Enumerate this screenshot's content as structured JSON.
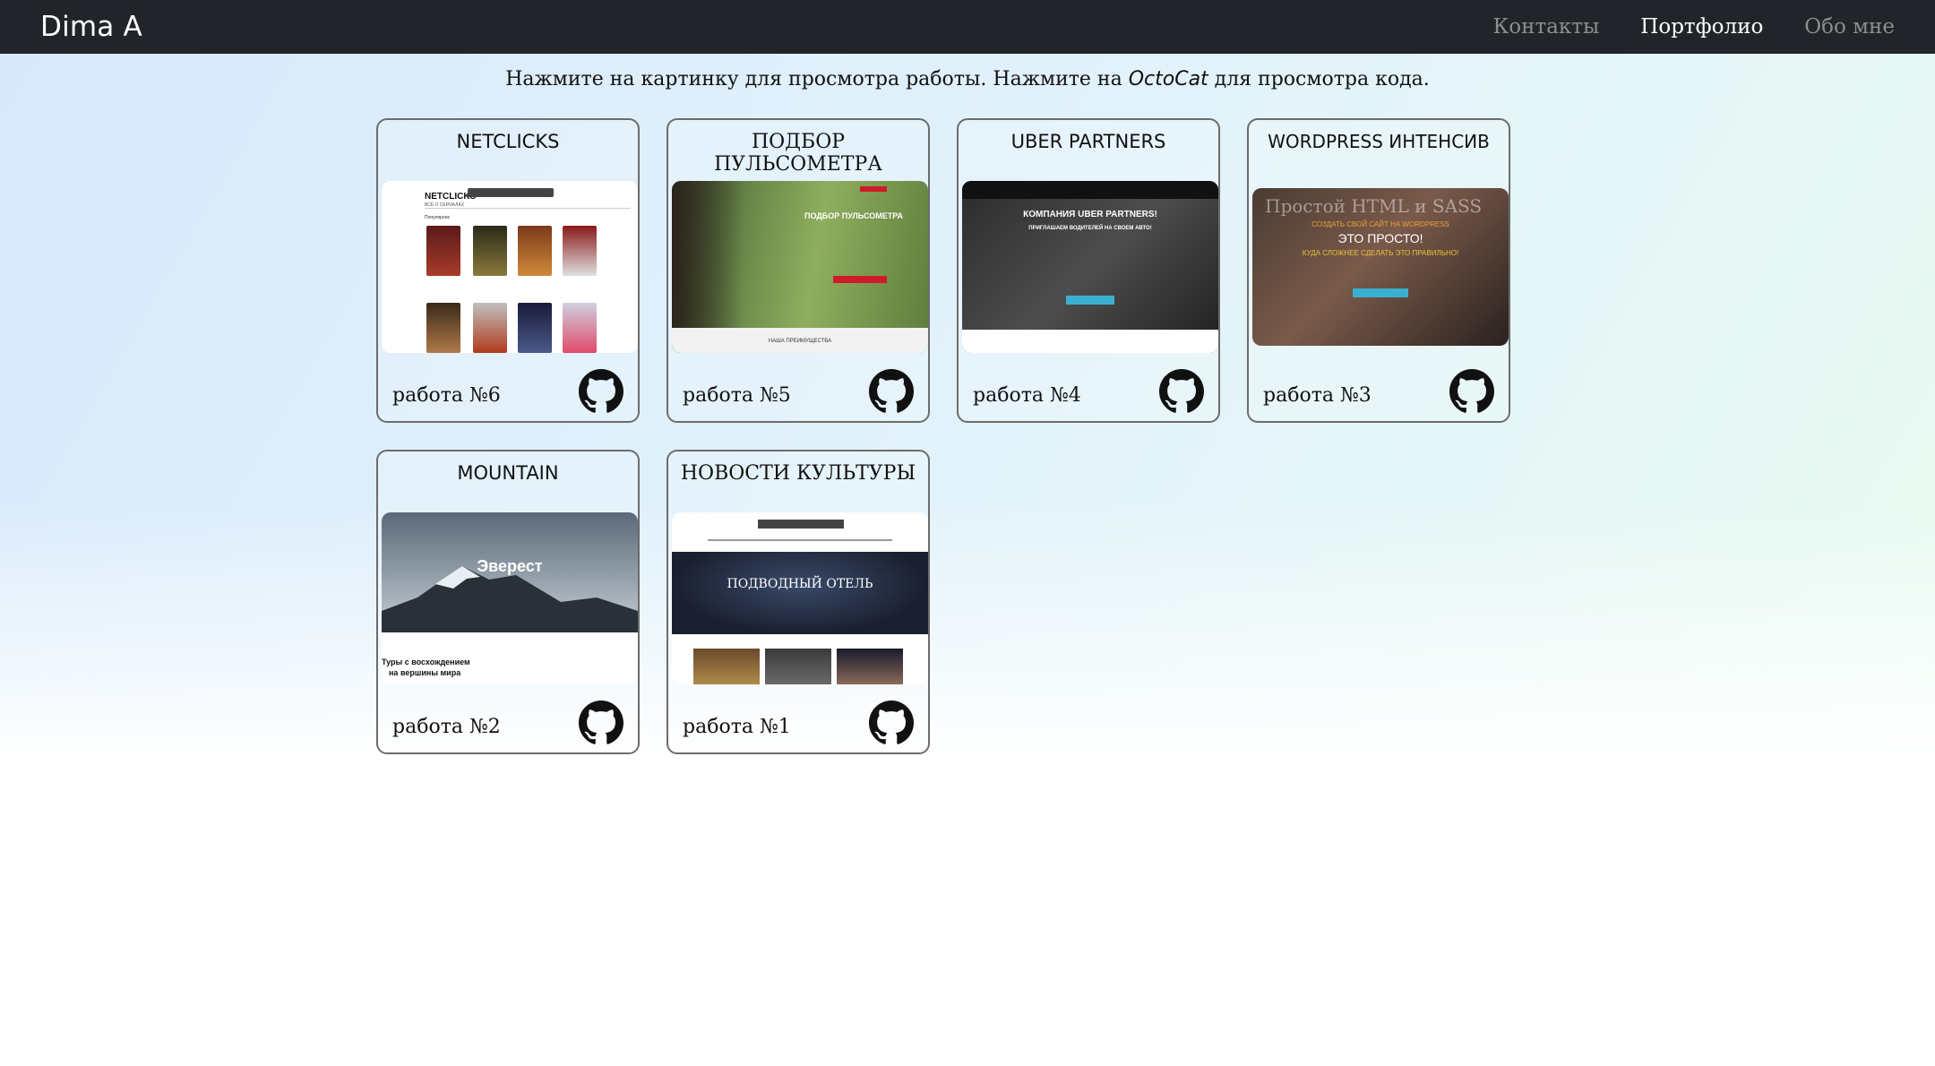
{
  "navbar": {
    "brand": "Dima A",
    "links": [
      {
        "label": "Контакты",
        "active": false
      },
      {
        "label": "Портфолио",
        "active": true
      },
      {
        "label": "Обо мне",
        "active": false
      }
    ]
  },
  "hint": {
    "before": "Нажмите на картинку для просмотра работы. Нажмите на ",
    "octocat": "OctoCat",
    "after": " для просмотра кода."
  },
  "cards": [
    {
      "title": "NETCLICKS",
      "caption": "работа №6",
      "icon": "github-icon",
      "thumb": {
        "logo": "NETCLICKS",
        "sub": "ВСЁ О СЕРИАЛАХ",
        "section": "Популярное"
      }
    },
    {
      "title": "ПОДБОР ПУЛЬСОМЕТРА",
      "caption": "работа №5",
      "icon": "github-icon",
      "thumb": {
        "heading": "ПОДБОР ПУЛЬСОМЕТРА",
        "footer": "НАША ПРЕИМУЩЕСТВА"
      }
    },
    {
      "title": "UBER PARTNERS",
      "caption": "работа №4",
      "icon": "github-icon",
      "thumb": {
        "heading": "КОМПАНИЯ UBER PARTNERS!",
        "sub": "ПРИГЛАШАЕМ ВОДИТЕЛЕЙ НА СВОЕМ АВТО!"
      }
    },
    {
      "title": "WORDPRESS ИНТЕНСИВ",
      "caption": "работа №3",
      "icon": "github-icon",
      "thumb": {
        "over": "Простой HTML и SASS",
        "line1": "СОЗДАТЬ СВОЙ САЙТ НА WORDPRESS",
        "heading": "ЭТО ПРОСТО!",
        "line2": "КУДА СЛОЖНЕЕ СДЕЛАТЬ ЭТО ПРАВИЛЬНО!"
      }
    },
    {
      "title": "MOUNTAIN",
      "caption": "работа №2",
      "icon": "github-icon",
      "thumb": {
        "heading": "Эверест",
        "sub1": "Туры с восхождением",
        "sub2": "на вершины мира"
      }
    },
    {
      "title": "НОВОСТИ КУЛЬТУРЫ",
      "caption": "работа №1",
      "icon": "github-icon",
      "thumb": {
        "heading": "ПОДВОДНЫЙ ОТЕЛЬ"
      }
    }
  ],
  "colors": {
    "navbar": "#212529",
    "nav_active": "#ffffff",
    "nav_inactive": "#8b8e91",
    "card_border": "#6c6c6c"
  }
}
